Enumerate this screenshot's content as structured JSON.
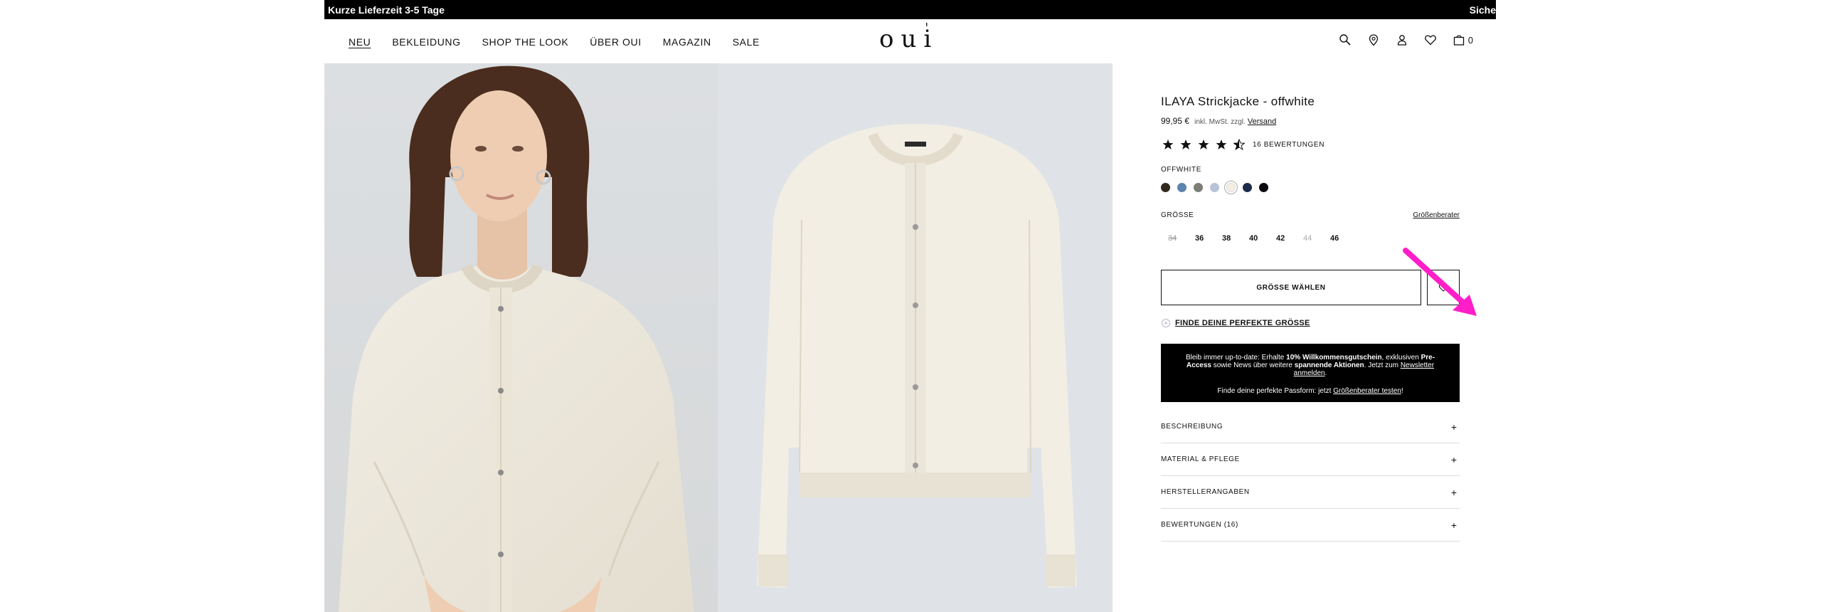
{
  "announcement": {
    "left": "Kurze Lieferzeit 3-5 Tage",
    "right": "Siche"
  },
  "nav": {
    "items": [
      {
        "label": "NEU",
        "active": true
      },
      {
        "label": "BEKLEIDUNG"
      },
      {
        "label": "SHOP THE LOOK"
      },
      {
        "label": "ÜBER OUI"
      },
      {
        "label": "MAGAZIN"
      },
      {
        "label": "SALE"
      }
    ]
  },
  "brand": {
    "logo": "oui",
    "logo_accent": "'"
  },
  "toolbar": {
    "icons": [
      "search-icon",
      "store-locator-icon",
      "account-icon",
      "wishlist-icon",
      "cart-icon"
    ],
    "cart_count": "0"
  },
  "product": {
    "title": "ILAYA Strickjacke - offwhite",
    "price": "99,95 €",
    "tax_note": "inkl. MwSt. zzgl.",
    "shipping_link": "Versand",
    "rating": 4.5,
    "reviews_label": "16 BEWERTUNGEN",
    "color_label": "OFFWHITE",
    "swatches": [
      "#2f2a1c",
      "#5d84ad",
      "#7d7d77",
      "#b9c3d8",
      "#f4efe2",
      "#1d2a4a",
      "#0b0b0f"
    ],
    "selected_swatch": 4,
    "size_label": "GRÖSSE",
    "size_guide": "Größenberater",
    "sizes": [
      {
        "label": "34",
        "state": "unavailable"
      },
      {
        "label": "36",
        "state": "available"
      },
      {
        "label": "38",
        "state": "available"
      },
      {
        "label": "40",
        "state": "available"
      },
      {
        "label": "42",
        "state": "available"
      },
      {
        "label": "44",
        "state": "soldout"
      },
      {
        "label": "46",
        "state": "available"
      }
    ],
    "choose_size_button": "GRÖSSE WÄHLEN",
    "fit_finder": "FINDE DEINE PERFEKTE GRÖSSE"
  },
  "promo": {
    "p1": "Bleib immer up-to-date: Erhalte",
    "b1": "10% Willkommensgutschein",
    "p2": ", exklusiven",
    "b2": "Pre-Access",
    "p3": "sowie News über weitere",
    "b3": "spannende Aktionen",
    "p4": ". Jetzt zum",
    "link1": "Newsletter anmelden",
    "p5": ".",
    "p6": "Finde deine perfekte Passform: jetzt",
    "link2": "Größenberater testen",
    "p7": "!"
  },
  "accordion": [
    {
      "label": "BESCHREIBUNG"
    },
    {
      "label": "MATERIAL & PFLEGE"
    },
    {
      "label": "HERSTELLERANGABEN"
    },
    {
      "label": "BEWERTUNGEN (16)"
    }
  ],
  "colors": {
    "accent_arrow": "#ff1ec8"
  }
}
